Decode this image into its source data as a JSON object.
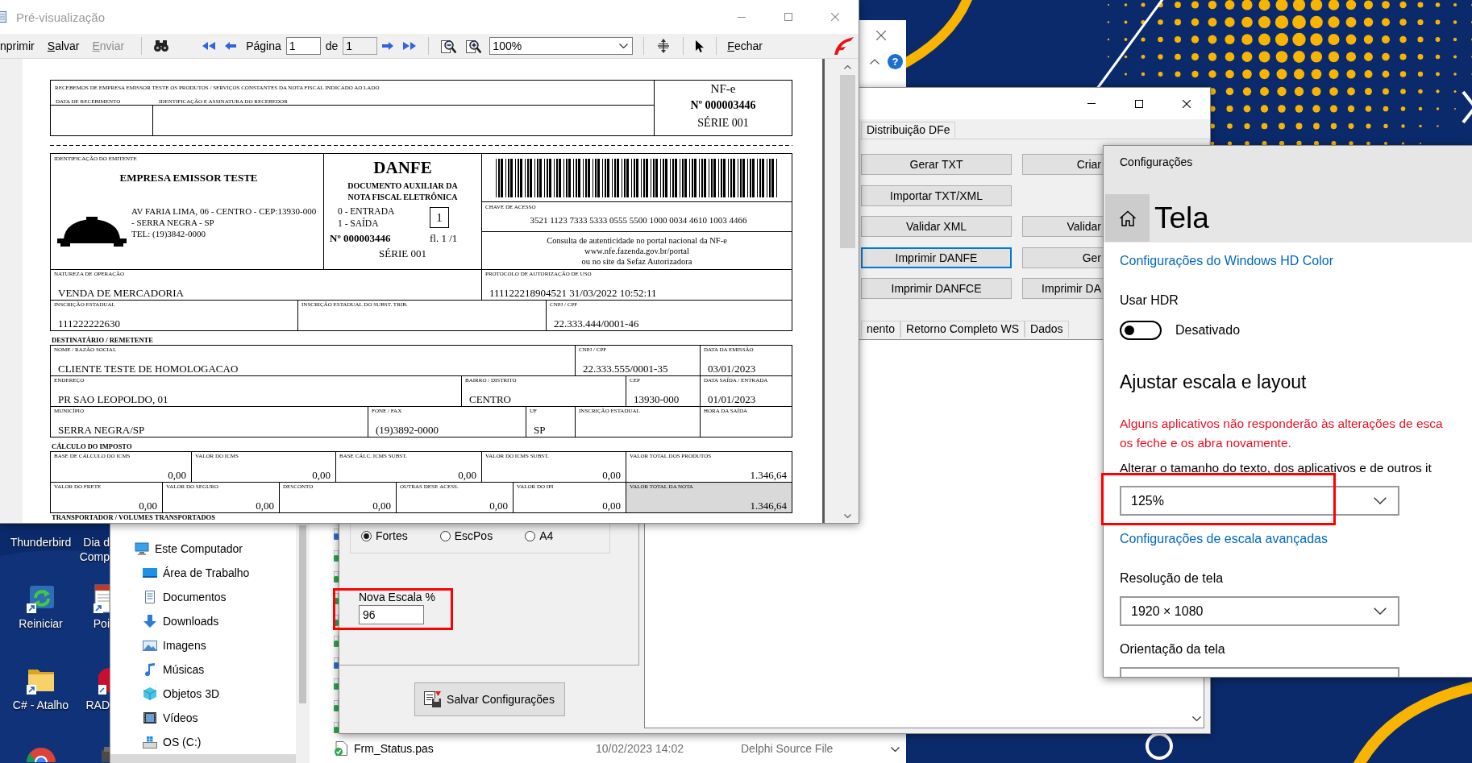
{
  "preview_window": {
    "title": "Pré-visualização",
    "toolbar": {
      "actions": [
        {
          "label": "nprimir",
          "mnemonic": false,
          "disabled": false
        },
        {
          "label": "Salvar",
          "mnemonic": true,
          "disabled": false
        },
        {
          "label": "Enviar",
          "mnemonic": true,
          "disabled": true
        }
      ],
      "page_label": "Página",
      "page": "1",
      "of_label": "de",
      "page_count": "1",
      "zoom": "100%",
      "close": {
        "label": "Fechar",
        "mnemonic": true,
        "disabled": false
      }
    },
    "danfe": {
      "receipt": {
        "text": "RECEBEMOS DE EMPRESA EMISSOR TESTE OS PRODUTOS / SERVIÇOS CONSTANTES DA NOTA FISCAL INDICADO AO LADO",
        "date_label": "DATA DE RECEBIMENTO",
        "signature_label": "IDENTIFICAÇÃO E ASSINATURA DO RECEBEDOR",
        "doc_type": "NF-e",
        "number": "Nº 000003446",
        "series": "SÉRIE 001"
      },
      "emitter": {
        "label": "IDENTIFICAÇÃO DO EMITENTE",
        "name": "EMPRESA EMISSOR TESTE",
        "address": "AV FARIA LIMA, 06 - CENTRO - CEP:13930-000 - SERRA NEGRA - SP",
        "phone": "TEL: (19)3842-0000"
      },
      "document": {
        "title": "DANFE",
        "subtitle": "DOCUMENTO AUXILIAR DA NOTA FISCAL ELETRÔNICA",
        "entry": "0 - ENTRADA",
        "exit": "1 - SAÍDA",
        "direction": "1",
        "number": "Nº 000003446",
        "sheet": "fl. 1 /1",
        "series": "SÉRIE 001"
      },
      "access_key": {
        "label": "CHAVE DE ACESSO",
        "value": "3521 1123 7333 5333 0555 5500 1000 0034 4610 1003 4466"
      },
      "consultation": [
        "Consulta de autenticidade no portal nacional da NF-e",
        "www.nfe.fazenda.gov.br/portal",
        "ou no site da Sefaz Autorizadora"
      ],
      "field_lines": [
        {
          "fields": [
            {
              "label": "NATUREZA DE OPERAÇÃO",
              "value": "VENDA DE MERCADORIA"
            },
            {
              "label": "PROTOCOLO DE AUTORIZAÇÃO DE USO",
              "value": "111122218904521 31/03/2022 10:52:11"
            }
          ]
        },
        {
          "fields": [
            {
              "label": "INSCRIÇÃO ESTADUAL",
              "value": "111222222630"
            },
            {
              "label": "INSCRIÇÃO ESTADUAL DO SUBST. TRIB."
            },
            {
              "label": "CNPJ / CPF",
              "value": "22.333.444/0001-46"
            }
          ]
        }
      ],
      "sections": [
        {
          "heading": "DESTINATÁRIO / REMETENTE",
          "field_lines": [
            {
              "fields": [
                {
                  "label": "NOME / RAZÃO SOCIAL",
                  "value": "CLIENTE TESTE DE HOMOLOGACAO"
                },
                {
                  "label": "CNPJ / CPF",
                  "value": "22.333.555/0001-35"
                },
                {
                  "label": "DATA DA EMISSÃO",
                  "value": "03/01/2023"
                }
              ]
            },
            {
              "fields": [
                {
                  "label": "ENDEREÇO",
                  "value": "PR SAO LEOPOLDO, 01"
                },
                {
                  "label": "BAIRRO / DISTRITO",
                  "value": "CENTRO"
                },
                {
                  "label": "CEP",
                  "value": "13930-000"
                },
                {
                  "label": "DATA SAÍDA / ENTRADA",
                  "value": "01/01/2023"
                }
              ]
            },
            {
              "fields": [
                {
                  "label": "MUNICÍPIO",
                  "value": "SERRA NEGRA/SP"
                },
                {
                  "label": "FONE / FAX",
                  "value": "(19)3892-0000"
                },
                {
                  "label": "UF",
                  "value": "SP"
                },
                {
                  "label": "INSCRIÇÃO ESTADUAL"
                },
                {
                  "label": "HORA DA SAÍDA"
                }
              ]
            }
          ]
        },
        {
          "heading": "CÁLCULO DO IMPOSTO",
          "field_lines": [
            {
              "fields": [
                {
                  "label": "BASE DE CÁLCULO DO ICMS",
                  "value": "0,00",
                  "highlighted": false
                },
                {
                  "label": "VALOR DO ICMS",
                  "value": "0,00",
                  "highlighted": false
                },
                {
                  "label": "BASE CÁLC. ICMS SUBST.",
                  "value": "0,00",
                  "highlighted": false
                },
                {
                  "label": "VALOR DO ICMS SUBST.",
                  "value": "0,00",
                  "highlighted": false
                },
                {
                  "label": "VALOR TOTAL DOS PRODUTOS",
                  "value": "1.346,64",
                  "highlighted": false
                }
              ]
            },
            {
              "fields": [
                {
                  "label": "VALOR DO FRETE",
                  "value": "0,00",
                  "highlighted": false
                },
                {
                  "label": "VALOR DO SEGURO",
                  "value": "0,00",
                  "highlighted": false
                },
                {
                  "label": "DESCONTO",
                  "value": "0,00",
                  "highlighted": false
                },
                {
                  "label": "OUTRAS DESP. ACESS.",
                  "value": "0,00",
                  "highlighted": false
                },
                {
                  "label": "VALOR DO IPI",
                  "value": "0,00",
                  "highlighted": false
                },
                {
                  "label": "VALOR TOTAL DA NOTA",
                  "value": "1.346,64",
                  "highlighted": true
                }
              ]
            }
          ]
        },
        {
          "heading": "TRANSPORTADOR / VOLUMES TRANSPORTADOS"
        }
      ]
    }
  },
  "back_window": {
    "help": "?"
  },
  "app_window": {
    "tabs": [
      {
        "label": "Distribuição DFe",
        "selected": false
      }
    ],
    "button_rows": [
      {
        "left": {
          "label": "Gerar TXT",
          "focused": false
        },
        "right": {
          "label": "Criar",
          "focused": false
        }
      },
      {
        "left": {
          "label": "Importar TXT/XML",
          "focused": false
        }
      },
      {
        "left": {
          "label": "Validar XML",
          "focused": false
        },
        "right": {
          "label": "Validar",
          "focused": false
        }
      },
      {
        "left": {
          "label": "Imprimir DANFE",
          "focused": true
        },
        "right": {
          "label": "Ger",
          "focused": false
        }
      },
      {
        "left": {
          "label": "Imprimir DANFCE",
          "focused": false
        },
        "right": {
          "label": "Imprimir DA",
          "focused": false
        }
      }
    ],
    "bottom_tabs": [
      {
        "label": "nento",
        "selected": false
      },
      {
        "label": "Retorno Completo WS",
        "selected": false
      },
      {
        "label": "Dados",
        "selected": false
      }
    ],
    "printer_options": [
      {
        "label": "Fortes",
        "selected": true
      },
      {
        "label": "EscPos",
        "selected": false
      },
      {
        "label": "A4",
        "selected": false
      }
    ],
    "scale_field": {
      "label": "Nova Escala %",
      "value": "96"
    },
    "save_button": "Salvar Configurações"
  },
  "explorer": {
    "nav_items": [
      {
        "label": "Este Computador",
        "kind": "pc",
        "selected": false,
        "children": [
          {
            "label": "Área de Trabalho",
            "kind": "desktop",
            "selected": false
          },
          {
            "label": "Documentos",
            "kind": "documents",
            "selected": false
          },
          {
            "label": "Downloads",
            "kind": "downloads",
            "selected": false
          },
          {
            "label": "Imagens",
            "kind": "pictures",
            "selected": false
          },
          {
            "label": "Músicas",
            "kind": "music",
            "selected": false
          },
          {
            "label": "Objetos 3D",
            "kind": "objects",
            "selected": false
          },
          {
            "label": "Vídeos",
            "kind": "videos",
            "selected": false
          },
          {
            "label": "OS (C:)",
            "kind": "drive",
            "selected": false
          },
          {
            "selected": true
          }
        ]
      }
    ],
    "files": [
      {
        "kind": "form"
      },
      {
        "kind": "unit"
      },
      {
        "kind": "unit"
      },
      {
        "kind": "unit"
      },
      {
        "kind": "unit"
      },
      {
        "kind": "unit"
      },
      {
        "kind": "form"
      },
      {
        "kind": "unit"
      },
      {
        "kind": "unit"
      },
      {
        "kind": "unit"
      },
      {
        "kind": "unit",
        "name": "Frm_Status.pas",
        "modified": "10/02/2023 14:02",
        "type": "Delphi Source File"
      }
    ]
  },
  "desktop": {
    "columns": [
      {
        "icons": [
          {
            "kind": "covered",
            "lines": [
              "Thunderbird"
            ]
          },
          {
            "kind": "restart",
            "lines": [
              "Reiniciar"
            ]
          },
          {
            "kind": "folder",
            "lines": [
              "C# - Atalho"
            ]
          },
          {
            "kind": "browser"
          }
        ]
      },
      {
        "icons": [
          {
            "kind": "covered",
            "lines": [
              "Dia d",
              "Comp"
            ]
          },
          {
            "kind": "document",
            "lines": [
              "Poi"
            ]
          },
          {
            "kind": "disc",
            "lines": [
              "RAD"
            ]
          },
          {
            "kind": "figure"
          }
        ]
      }
    ]
  },
  "settings_window": {
    "title": "Configurações",
    "page_title": "Tela",
    "hdr_link": "Configurações do Windows HD Color",
    "hdr_label": "Usar HDR",
    "hdr_toggle": {
      "on": false,
      "label": "Desativado"
    },
    "heading": "Ajustar escala e layout",
    "warning_lines": [
      "Alguns aplicativos não responderão às alterações de esca",
      "os feche e os abra novamente."
    ],
    "scale_label": "Alterar o tamanho do texto, dos aplicativos e de outros it",
    "scale": "125%",
    "advanced_link": "Configurações de escala avançadas",
    "resolution_label": "Resolução de tela",
    "resolution": "1920 × 1080",
    "orientation_label": "Orientação da tela"
  }
}
